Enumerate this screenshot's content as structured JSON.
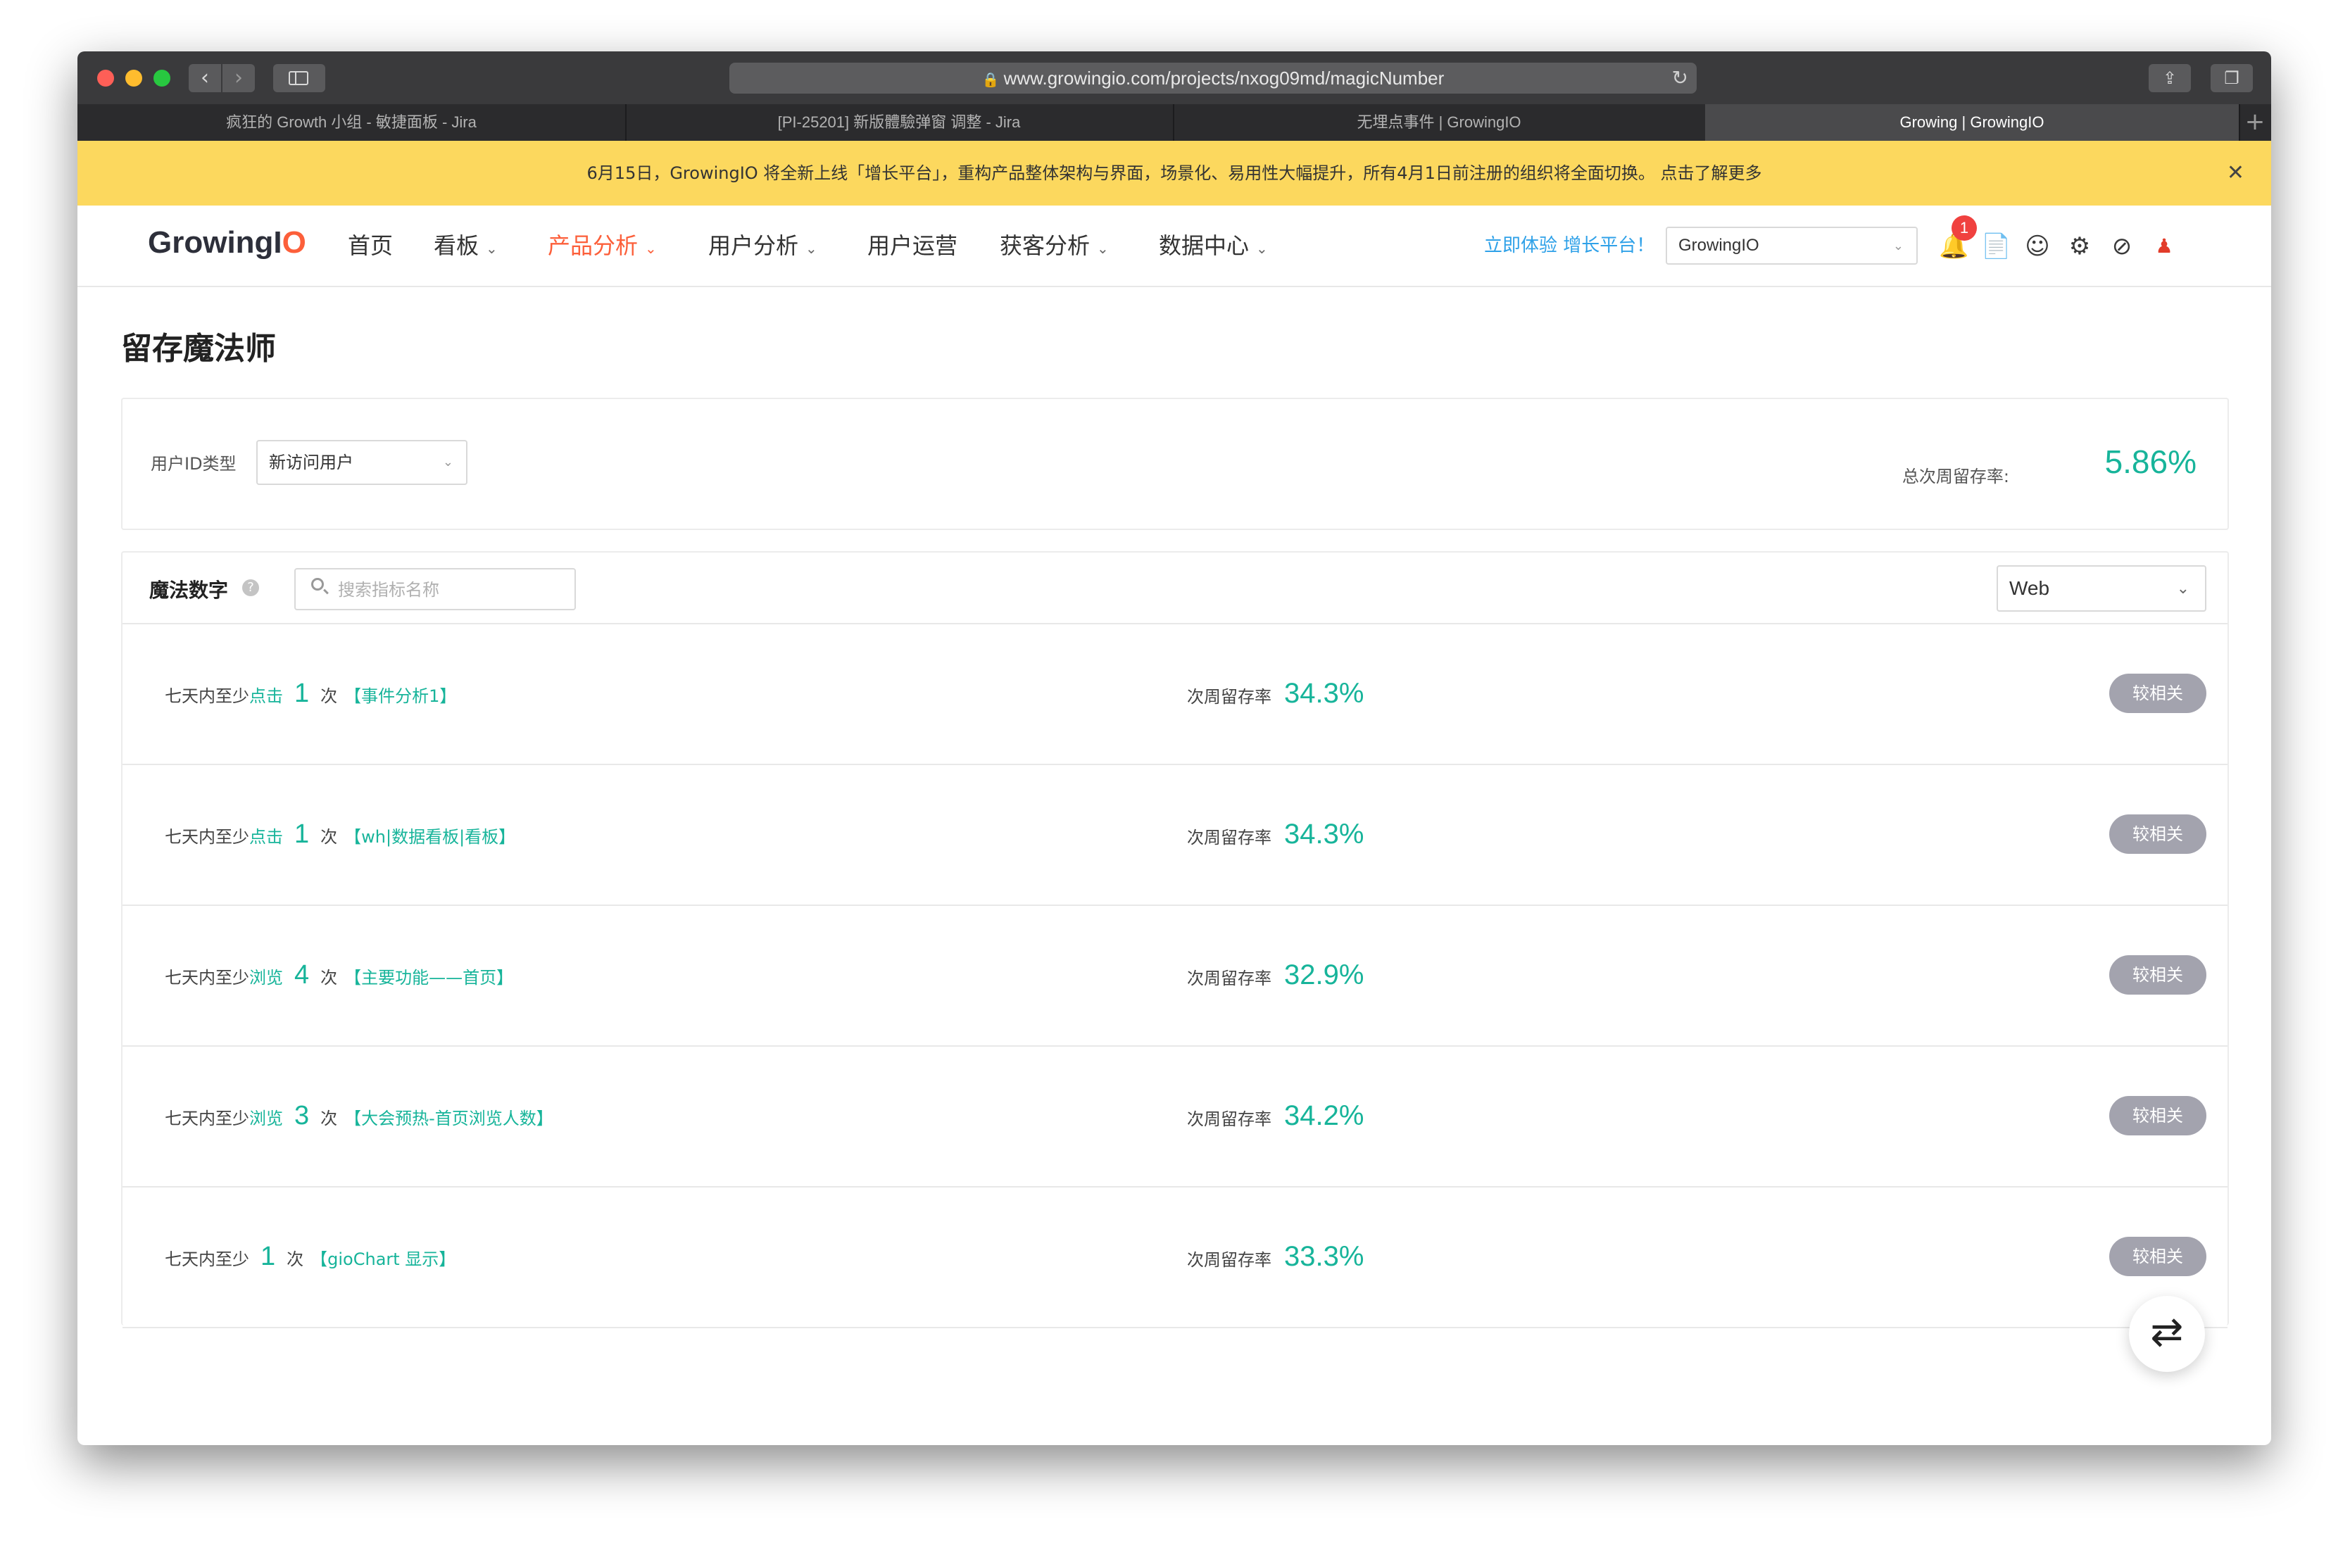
{
  "browser": {
    "url": "www.growingio.com/projects/nxog09md/magicNumber",
    "tabs": [
      {
        "label": "疯狂的 Growth 小组 - 敏捷面板 - Jira"
      },
      {
        "label": "[PI-25201] 新版體驗弹窗 调整 - Jira"
      },
      {
        "label": "无埋点事件 | GrowingIO"
      },
      {
        "label": "Growing | GrowingIO",
        "active": true
      }
    ]
  },
  "banner": {
    "text": "6月15日，GrowingIO 将全新上线「增长平台」，重构产品整体架构与界面，场景化、易用性大幅提升，所有4月1日前注册的组织将全面切换。 点击了解更多"
  },
  "header": {
    "logo_main": "GrowingI",
    "logo_o": "O",
    "nav": [
      {
        "label": "首页",
        "dropdown": false
      },
      {
        "label": "看板",
        "dropdown": true
      },
      {
        "label": "产品分析",
        "dropdown": true,
        "active": true
      },
      {
        "label": "用户分析",
        "dropdown": true
      },
      {
        "label": "用户运营",
        "dropdown": false
      },
      {
        "label": "获客分析",
        "dropdown": true
      },
      {
        "label": "数据中心",
        "dropdown": true
      }
    ],
    "try_link": "立即体验 增长平台！",
    "project_selector": "GrowingIO",
    "notification_count": "1",
    "accent_color": "#fc5f3a"
  },
  "page": {
    "title": "留存魔法师",
    "filter": {
      "label": "用户ID类型",
      "value": "新访问用户",
      "total_label": "总次周留存率:",
      "total_value": "5.86%"
    },
    "list": {
      "title": "魔法数字",
      "search_placeholder": "搜索指标名称",
      "platform": "Web",
      "rate_label": "次周留存率",
      "tag_label": "较相关",
      "rows": [
        {
          "prefix": "七天内至少",
          "action": "点击",
          "count": "1",
          "unit": "次",
          "event": "【事件分析1】",
          "rate": "34.3%"
        },
        {
          "prefix": "七天内至少",
          "action": "点击",
          "count": "1",
          "unit": "次",
          "event": "【wh|数据看板|看板】",
          "rate": "34.3%"
        },
        {
          "prefix": "七天内至少",
          "action": "浏览",
          "count": "4",
          "unit": "次",
          "event": "【主要功能——首页】",
          "rate": "32.9%"
        },
        {
          "prefix": "七天内至少",
          "action": "浏览",
          "count": "3",
          "unit": "次",
          "event": "【大会预热-首页浏览人数】",
          "rate": "34.2%"
        },
        {
          "prefix": "七天内至少",
          "action": "",
          "count": "1",
          "unit": "次",
          "event": "【gioChart 显示】",
          "rate": "33.3%"
        }
      ]
    },
    "highlight_color": "#17b49a"
  }
}
